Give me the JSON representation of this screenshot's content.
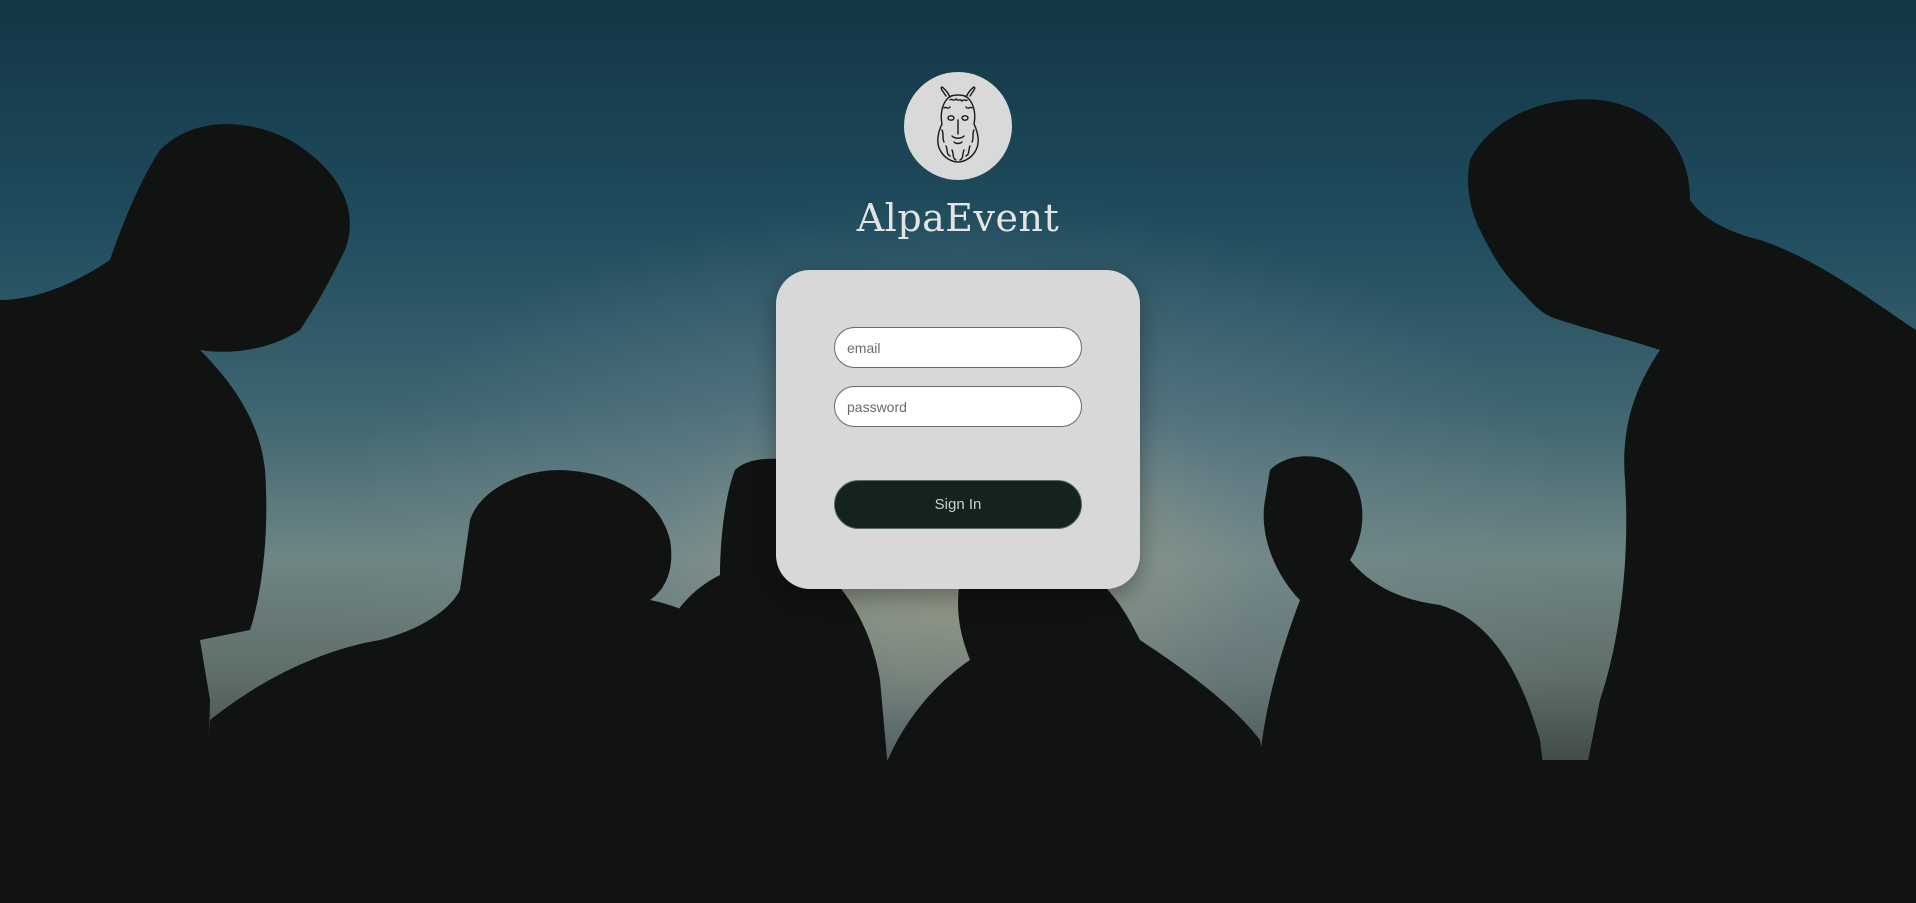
{
  "app": {
    "title": "AlpaEvent",
    "logo_icon": "alpaca-head-icon"
  },
  "login": {
    "email_placeholder": "email",
    "email_value": "",
    "password_placeholder": "password",
    "password_value": "",
    "signin_label": "Sign In"
  },
  "colors": {
    "card_bg": "#d8d8d8",
    "button_bg": "#14231f",
    "logo_circle_bg": "#d9d9d9",
    "sky_top": "#143645",
    "silhouette": "#111212"
  }
}
